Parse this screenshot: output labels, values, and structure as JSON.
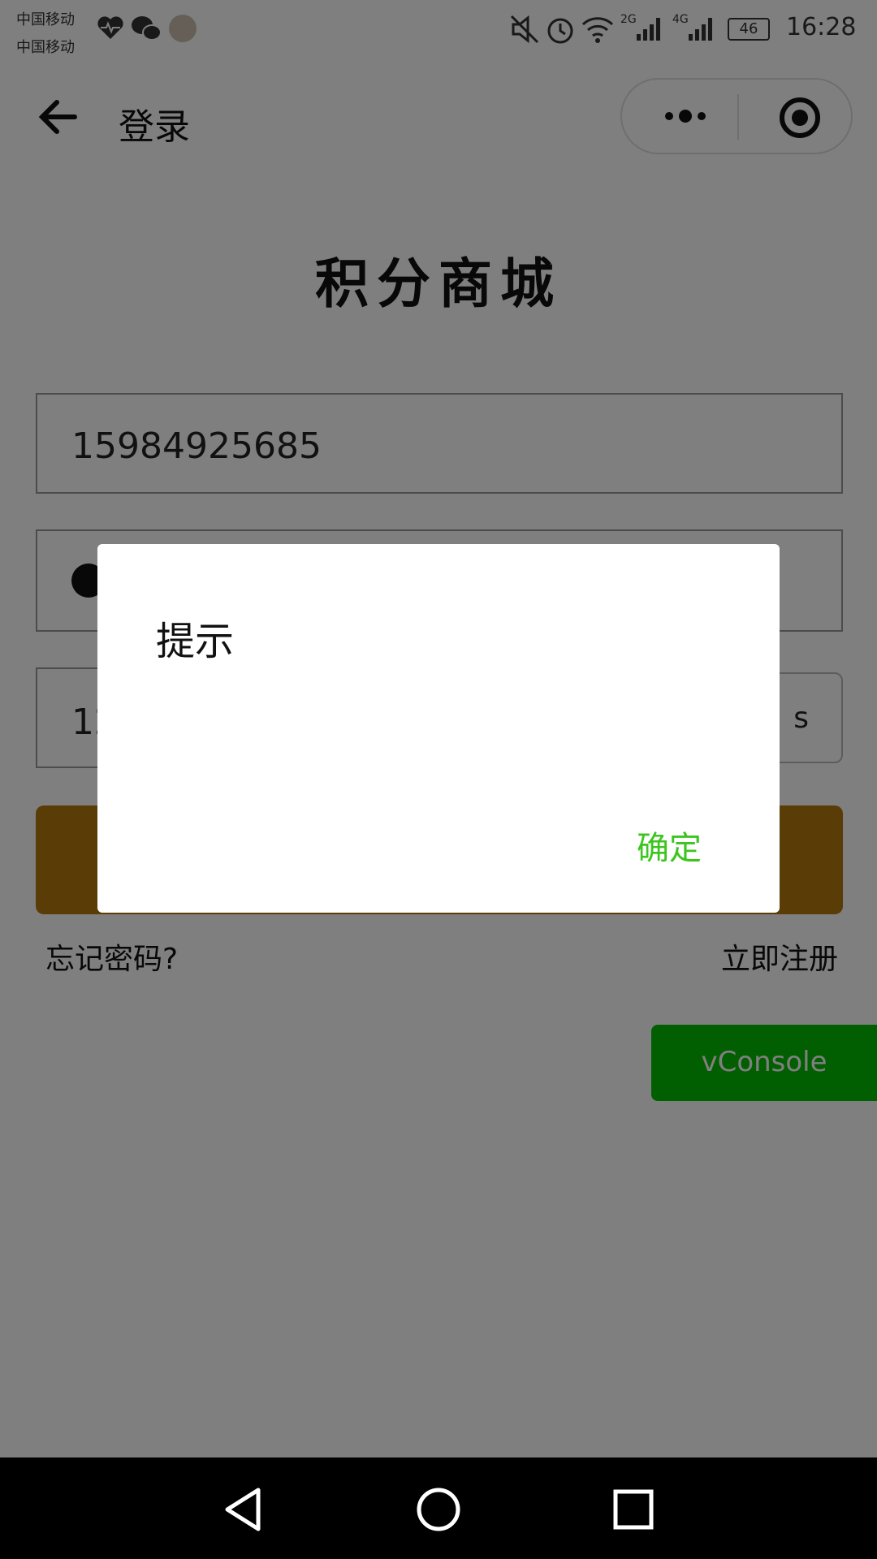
{
  "status_bar": {
    "carrier_1": "中国移动",
    "carrier_2": "中国移动",
    "network_1": "2G",
    "network_2": "4G",
    "battery": "46",
    "time": "16:28"
  },
  "header": {
    "title": "登录"
  },
  "app_title": "积分商城",
  "form": {
    "phone_value": "15984925685",
    "code_value": "12",
    "code_button_fragment": "s"
  },
  "links": {
    "forgot_password": "忘记密码?",
    "register": "立即注册"
  },
  "vconsole": "vConsole",
  "modal": {
    "title": "提示",
    "confirm": "确定"
  },
  "colors": {
    "login_button": "#B5790C",
    "confirm_text": "#3CC51F",
    "vconsole_bg": "#04BE02"
  }
}
